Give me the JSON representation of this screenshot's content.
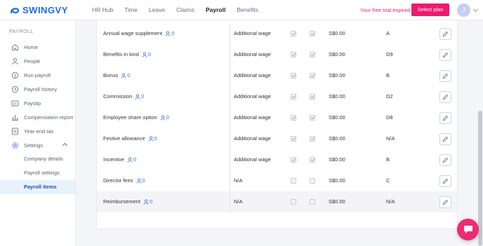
{
  "brand": {
    "name": "SWINGVY",
    "accent": "#1b6ee6"
  },
  "topnav": {
    "items": [
      {
        "label": "HR Hub",
        "active": false
      },
      {
        "label": "Time",
        "active": false
      },
      {
        "label": "Leave",
        "active": false
      },
      {
        "label": "Claims",
        "active": false
      },
      {
        "label": "Payroll",
        "active": true
      },
      {
        "label": "Benefits",
        "active": false
      }
    ],
    "trial_text": "Your free trial expired",
    "select_plan_label": "Select plan",
    "avatar_initial": "J"
  },
  "sidebar": {
    "section_title": "PAYROLL",
    "items": [
      {
        "label": "Home",
        "icon": "home-icon"
      },
      {
        "label": "People",
        "icon": "user-icon"
      },
      {
        "label": "Run payroll",
        "icon": "dollar-cycle-icon"
      },
      {
        "label": "Payroll history",
        "icon": "history-icon"
      },
      {
        "label": "Payslip",
        "icon": "payslip-icon"
      },
      {
        "label": "Compensation report",
        "icon": "report-icon"
      },
      {
        "label": "Year-end tax",
        "icon": "tax-icon"
      },
      {
        "label": "Settings",
        "icon": "gear-icon",
        "expanded": true
      }
    ],
    "sub_items": [
      {
        "label": "Company details",
        "active": false
      },
      {
        "label": "Payroll settings",
        "active": false
      },
      {
        "label": "Payroll items",
        "active": true
      }
    ]
  },
  "table": {
    "rows": [
      {
        "name": "Annual wage supplement",
        "people": "0",
        "type": "Additional wage",
        "check1": true,
        "check2": true,
        "amount": "S$0.00",
        "code": "A"
      },
      {
        "name": "Benefits in kind",
        "people": "0",
        "type": "Additional wage",
        "check1": true,
        "check2": true,
        "amount": "S$0.00",
        "code": "D9"
      },
      {
        "name": "Bonus",
        "people": "0",
        "type": "Additional wage",
        "check1": true,
        "check2": true,
        "amount": "S$0.00",
        "code": "B"
      },
      {
        "name": "Commission",
        "people": "0",
        "type": "Additional wage",
        "check1": true,
        "check2": true,
        "amount": "S$0.00",
        "code": "D2"
      },
      {
        "name": "Employee share option",
        "people": "0",
        "type": "Additional wage",
        "check1": true,
        "check2": true,
        "amount": "S$0.00",
        "code": "D8"
      },
      {
        "name": "Festive allowance",
        "people": "0",
        "type": "Additional wage",
        "check1": true,
        "check2": true,
        "amount": "S$0.00",
        "code": "N/A"
      },
      {
        "name": "Incentive",
        "people": "0",
        "type": "Additional wage",
        "check1": true,
        "check2": true,
        "amount": "S$0.00",
        "code": "B"
      },
      {
        "name": "Director fees",
        "people": "0",
        "type": "N/A",
        "check1": false,
        "check2": false,
        "amount": "S$0.00",
        "code": "C"
      },
      {
        "name": "Reimbursement",
        "people": "0",
        "type": "N/A",
        "check1": false,
        "check2": false,
        "amount": "S$0.00",
        "code": "N/A"
      }
    ]
  }
}
